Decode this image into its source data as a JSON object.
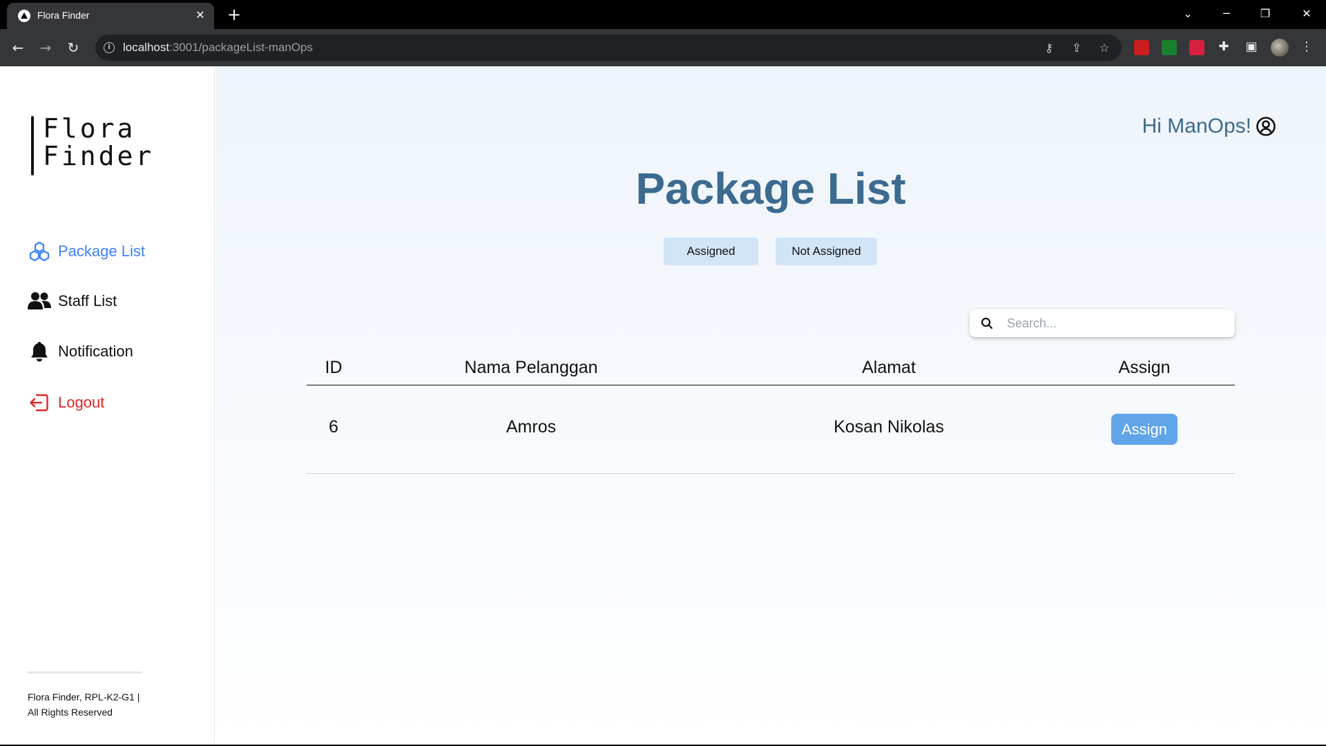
{
  "browser": {
    "tab_title": "Flora Finder",
    "tab_close": "✕",
    "new_tab": "+",
    "url_host": "localhost",
    "url_rest": ":3001/packageList-manOps"
  },
  "sidebar": {
    "logo_line1": "Flora",
    "logo_line2": "Finder",
    "items": [
      {
        "label": "Package List",
        "icon": "cubes-icon",
        "active": true
      },
      {
        "label": "Staff List",
        "icon": "users-icon",
        "active": false
      },
      {
        "label": "Notification",
        "icon": "bell-icon",
        "active": false
      },
      {
        "label": "Logout",
        "icon": "logout-icon",
        "active": false
      }
    ],
    "footer_line1": "Flora Finder, RPL-K2-G1 |",
    "footer_line2": "All Rights Reserved"
  },
  "header": {
    "greeting": "Hi ManOps!"
  },
  "main": {
    "title": "Package List",
    "filters": [
      "Assigned",
      "Not Assigned"
    ],
    "search_placeholder": "Search..."
  },
  "table": {
    "columns": [
      "ID",
      "Nama Pelanggan",
      "Alamat",
      "Assign"
    ],
    "rows": [
      {
        "id": "6",
        "nama": "Amros",
        "alamat": "Kosan Nikolas",
        "action": "Assign"
      }
    ]
  },
  "colors": {
    "accent_blue": "#3b82f6",
    "title_blue": "#3d6a8f",
    "logout_red": "#dc2626",
    "assign_button": "#60a5e8",
    "filter_button": "#d2e4f8"
  }
}
